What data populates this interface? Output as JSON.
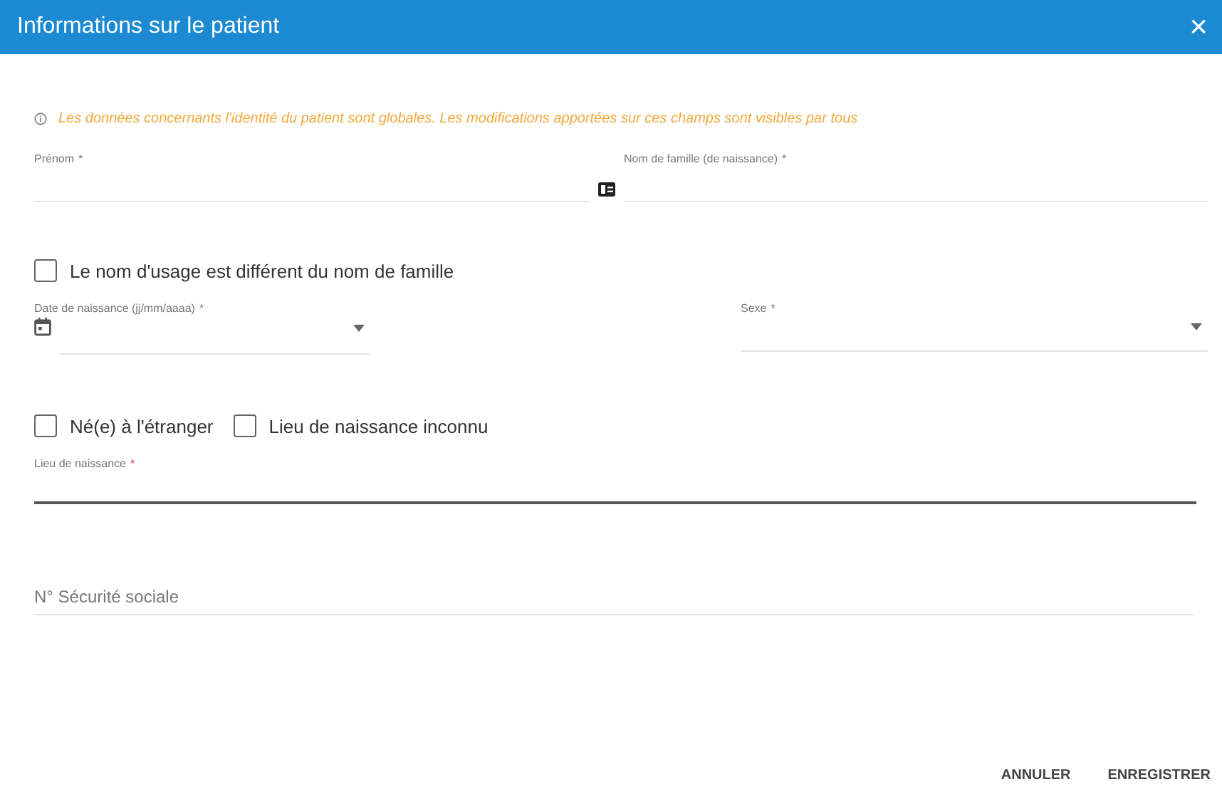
{
  "window": {
    "title": "Informations sur le patient",
    "close": "×"
  },
  "notice": "Les données concernants l'identité du patient sont globales. Les modifications apportées sur ces champs sont visibles par tous",
  "names": [
    {
      "label": "Prénom",
      "required_mark": "*",
      "focused": false,
      "kind": "card"
    },
    {
      "label": "Nom de famille (de naissance)",
      "required_mark": "*",
      "focused": false,
      "kind": "text"
    }
  ],
  "usage_checkbox": {
    "label": "Le nom d'usage est différent du nom de famille",
    "checked": false
  },
  "birth": [
    {
      "label": "Date de naissance (jj/mm/aaaa)",
      "required_mark": "*",
      "focused": false,
      "kind": "date"
    },
    {
      "label": "Sexe",
      "required_mark": "*",
      "focused": false,
      "kind": "select"
    }
  ],
  "place_checkboxes": [
    {
      "label": "Né(e) à l'étranger",
      "checked": false
    },
    {
      "label": "Lieu de naissance inconnu",
      "checked": false
    }
  ],
  "birthplace": {
    "label": "Lieu de naissance",
    "required_mark": "*",
    "focused": true
  },
  "social_security": {
    "placeholder": "N° Sécurité sociale"
  },
  "buttons": [
    "ANNULER",
    "ENREGISTRER"
  ]
}
